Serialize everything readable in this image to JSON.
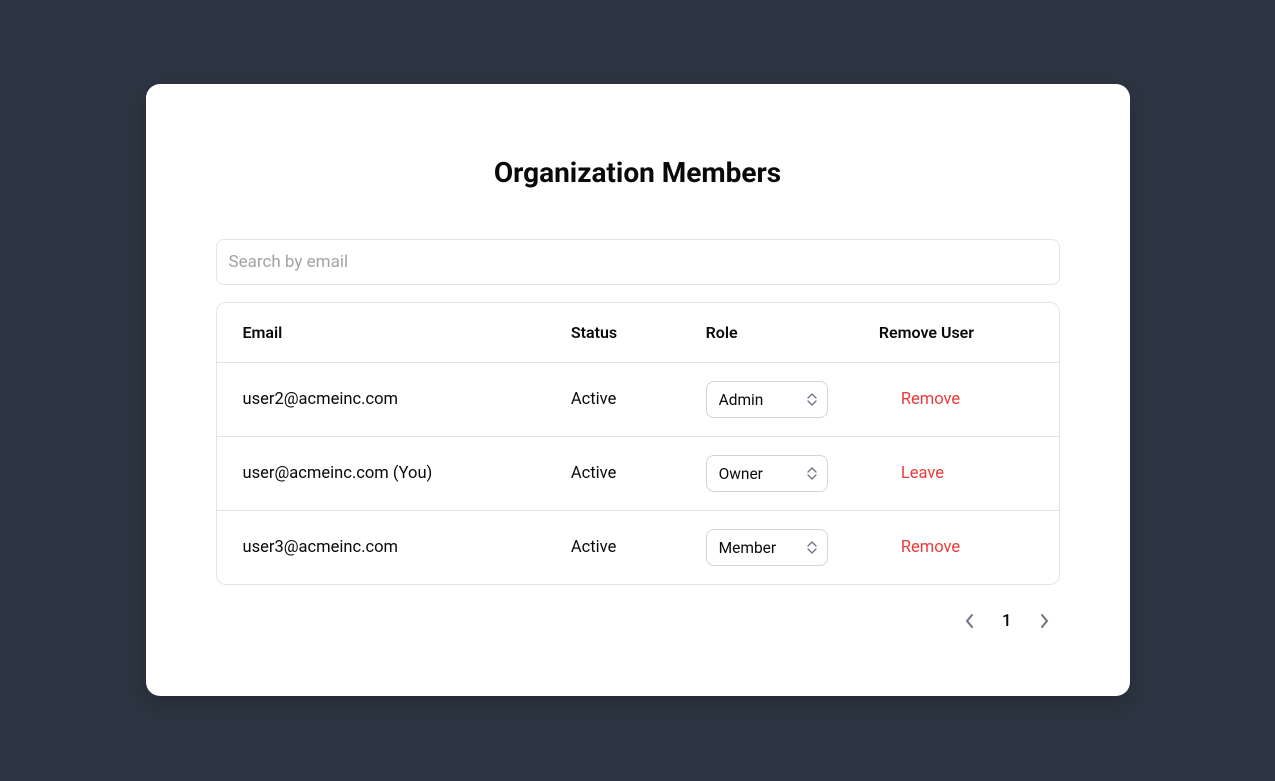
{
  "title": "Organization Members",
  "search": {
    "placeholder": "Search by email",
    "value": ""
  },
  "columns": {
    "email": "Email",
    "status": "Status",
    "role": "Role",
    "action": "Remove User"
  },
  "rows": [
    {
      "email": "user2@acmeinc.com",
      "status": "Active",
      "role": "Admin",
      "action": "Remove"
    },
    {
      "email": "user@acmeinc.com (You)",
      "status": "Active",
      "role": "Owner",
      "action": "Leave"
    },
    {
      "email": "user3@acmeinc.com",
      "status": "Active",
      "role": "Member",
      "action": "Remove"
    }
  ],
  "pagination": {
    "current": "1"
  }
}
